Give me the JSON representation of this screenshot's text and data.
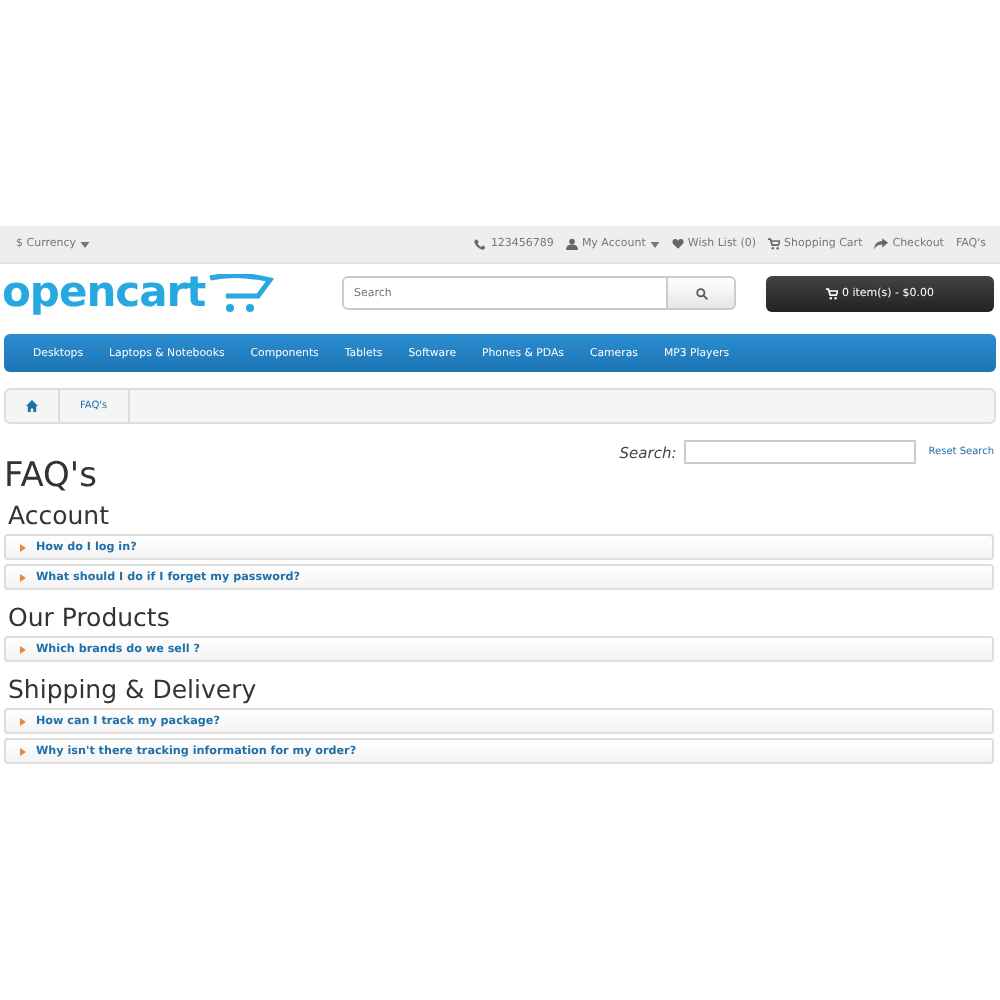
{
  "topbar": {
    "currency": "$ Currency",
    "links": [
      "123456789",
      "My Account",
      "Wish List (0)",
      "Shopping Cart",
      "Checkout",
      "FAQ's"
    ]
  },
  "header": {
    "logo": "opencart",
    "search": {
      "placeholder": "Search"
    },
    "cart": "0 item(s) - $0.00"
  },
  "nav": [
    "Desktops",
    "Laptops & Notebooks",
    "Components",
    "Tablets",
    "Software",
    "Phones & PDAs",
    "Cameras",
    "MP3 Players"
  ],
  "breadcrumb": [
    "FAQ's"
  ],
  "faq_search": {
    "label": "Search:",
    "reset": "Reset Search"
  },
  "title": "FAQ's",
  "sections": [
    {
      "heading": "Account",
      "items": [
        {
          "question": "How do I log in?",
          "expanded": false
        },
        {
          "question": "What should I do if I forget my password?",
          "expanded": false
        }
      ]
    },
    {
      "heading": "Our Products",
      "items": [
        {
          "question": "Which brands do we sell ?",
          "expanded": false
        }
      ]
    },
    {
      "heading": "Shipping & Delivery",
      "items": [
        {
          "question": "How can I track my package?",
          "expanded": false
        },
        {
          "question": "Why isn't there tracking information for my order?",
          "expanded": false
        }
      ]
    }
  ]
}
